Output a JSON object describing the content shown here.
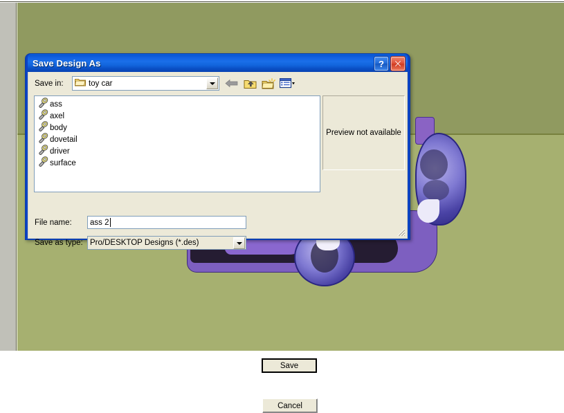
{
  "dialog": {
    "title": "Save Design As",
    "help_button": "?",
    "close_button": "✕",
    "save_in_label": "Save in:",
    "save_in_value": "toy car",
    "toolbar": [
      {
        "name": "back-icon",
        "tooltip": "Back"
      },
      {
        "name": "up-one-level-icon",
        "tooltip": "Up One Level"
      },
      {
        "name": "create-new-folder-icon",
        "tooltip": "Create New Folder"
      },
      {
        "name": "views-icon",
        "tooltip": "Views"
      }
    ],
    "files": [
      {
        "name": "ass",
        "icon": "design-file-icon"
      },
      {
        "name": "axel",
        "icon": "design-file-icon"
      },
      {
        "name": "body",
        "icon": "design-file-icon"
      },
      {
        "name": "dovetail",
        "icon": "design-file-icon"
      },
      {
        "name": "driver",
        "icon": "design-file-icon"
      },
      {
        "name": "surface",
        "icon": "design-file-icon"
      }
    ],
    "preview_text": "Preview not available",
    "file_name_label": "File name:",
    "file_name_value": "ass 2",
    "save_as_type_label": "Save as type:",
    "save_as_type_value": "Pro/DESKTOP Designs (*.des)",
    "save_button": "Save",
    "cancel_button": "Cancel"
  },
  "colors": {
    "titlebar_blue": "#1a6fe8",
    "dialog_face": "#ece9d8",
    "viewport_green": "#909a60",
    "ground_green": "#a6b070",
    "model_purple": "#7d5fc0",
    "wheel_blue": "#4a43a5",
    "close_red": "#cf3c22"
  }
}
